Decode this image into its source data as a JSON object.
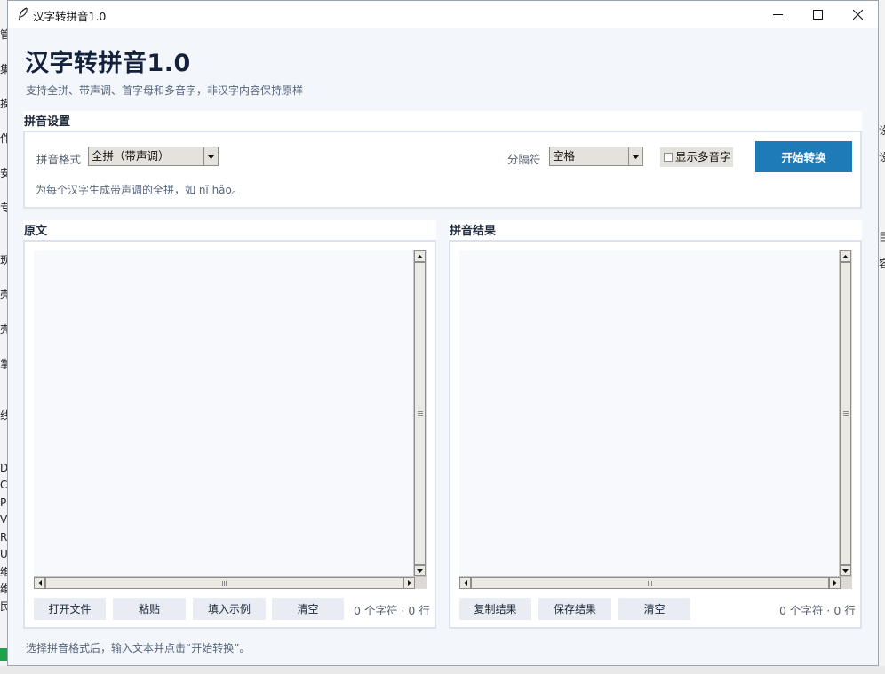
{
  "window": {
    "title": "汉字转拼音1.0",
    "controls": [
      "minimize",
      "maximize",
      "close"
    ]
  },
  "header": {
    "title": "汉字转拼音1.0",
    "subtitle": "支持全拼、带声调、首字母和多音字，非汉字内容保持原样"
  },
  "settings": {
    "section_title": "拼音设置",
    "format_label": "拼音格式",
    "format_value": "全拼（带声调）",
    "separator_label": "分隔符",
    "separator_value": "空格",
    "polyphone_label": "显示多音字",
    "polyphone_checked": false,
    "convert_button": "开始转换",
    "hint": "为每个汉字生成带声调的全拼，如 nǐ hǎo。"
  },
  "source": {
    "section_title": "原文",
    "text": "",
    "buttons": {
      "open_file": "打开文件",
      "paste": "粘贴",
      "fill_example": "填入示例",
      "clear": "清空"
    },
    "count": "0 个字符 · 0 行"
  },
  "result": {
    "section_title": "拼音结果",
    "text": "",
    "buttons": {
      "copy": "复制结果",
      "save": "保存结果",
      "clear": "清空"
    },
    "count": "0 个字符 · 0 行"
  },
  "status_bar": "选择拼音格式后，输入文本并点击“开始转换”。",
  "colors": {
    "accent": "#1f7ab8",
    "window_bg": "#f3f6fb",
    "panel_border": "#dbe3ee",
    "title": "#14213d"
  },
  "background": {
    "left_edge_glyphs": "管\n\n集\n\n摸\n\n件\n\n安\n\n专\n\n\n现\n\n壳\n\n壳\n\n掌\n\n\n线\n\n\nD\nC\nP\nV\nR\nU\n维\n维\n民",
    "right_edge_glyphs": "设\n设\n\n\n目\n容"
  }
}
